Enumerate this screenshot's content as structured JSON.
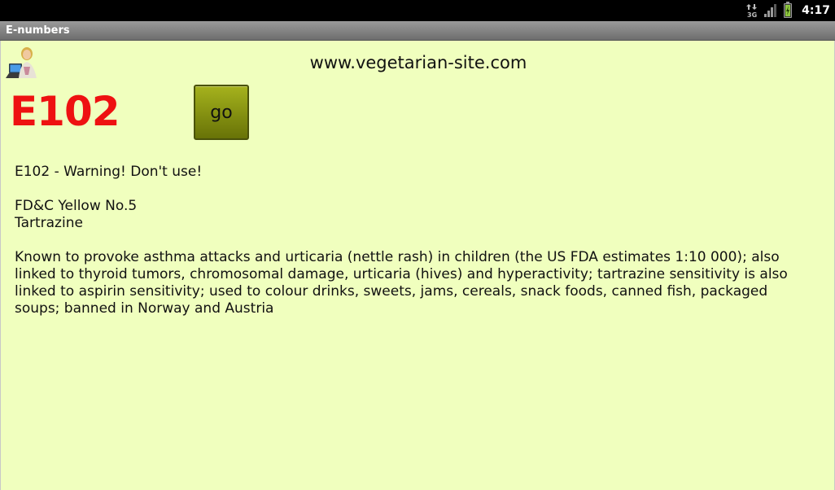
{
  "status_bar": {
    "time": "4:17",
    "network_type": "3G",
    "signal_level_bars": 3,
    "signal_max_bars": 4,
    "battery_level": 1.0,
    "battery_charging": true
  },
  "app": {
    "title": "E-numbers"
  },
  "header": {
    "site_url": "www.vegetarian-site.com"
  },
  "lookup": {
    "code": "E102",
    "go_label": "go"
  },
  "details": {
    "warning": "E102 - Warning! Don't use!",
    "name_line_1": "FD&C Yellow No.5",
    "name_line_2": "Tartrazine",
    "description": "Known to provoke asthma attacks and urticaria (nettle rash) in children (the US FDA estimates 1:10 000); also linked to thyroid tumors, chromosomal damage, urticaria (hives) and hyperactivity; tartrazine sensitivity is also linked to aspirin sensitivity; used to colour drinks, sweets, jams, cereals, snack foods, canned fish, packaged soups; banned in Norway and Austria"
  },
  "colors": {
    "background": "#f0ffbe",
    "code_red": "#ee1111",
    "button_olive": "#8c9a12"
  }
}
